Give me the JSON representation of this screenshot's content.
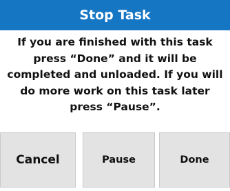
{
  "dialog": {
    "title": "Stop Task",
    "message": "If you are finished with this task\npress “Done” and it will be\ncompleted and unloaded. If you will\ndo more work on this task later\npress “Pause”.",
    "buttons": {
      "cancel": "Cancel",
      "pause": "Pause",
      "done": "Done"
    }
  },
  "colors": {
    "title_bar": "#1576c4",
    "title_text": "#ffffff",
    "button_bg": "#e3e3e3",
    "text": "#111111"
  }
}
